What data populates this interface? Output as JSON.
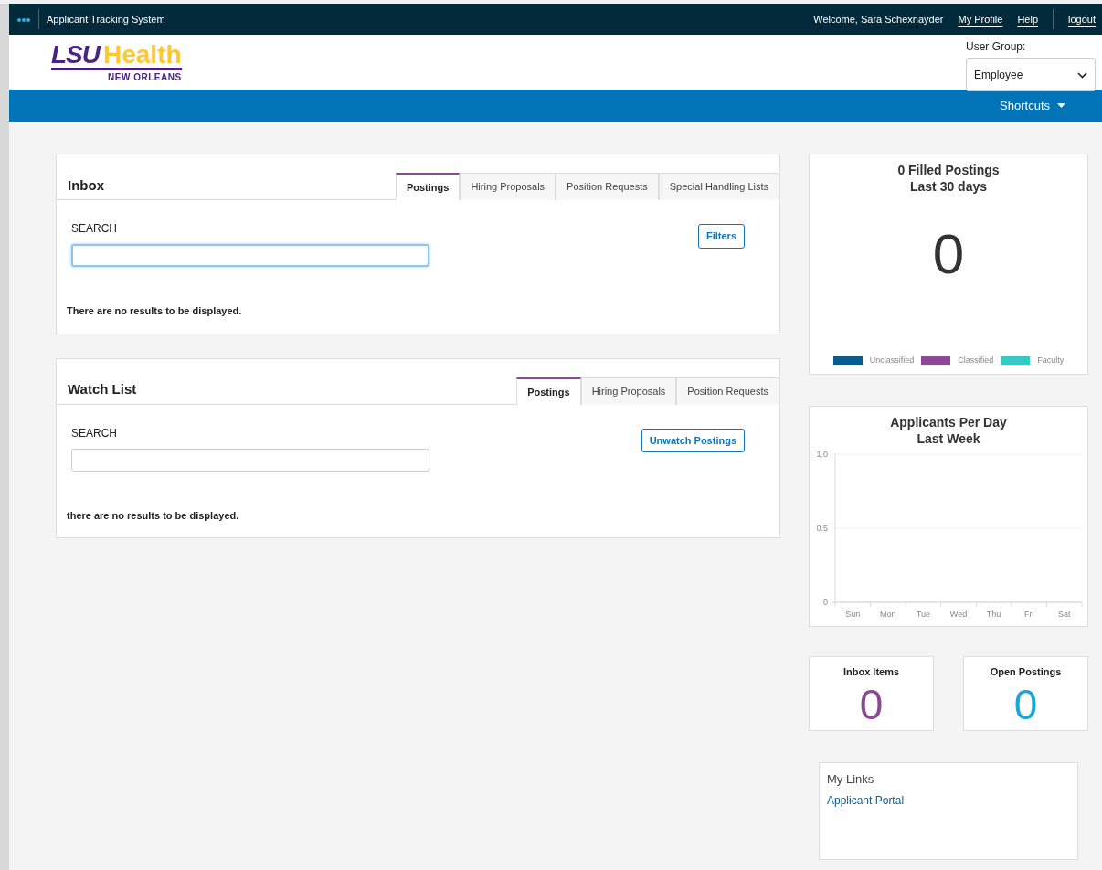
{
  "topbar": {
    "app_title": "Applicant Tracking System",
    "welcome": "Welcome, Sara Schexnayder",
    "links": [
      "My Profile",
      "Help",
      "logout"
    ]
  },
  "logo": {
    "primary": "LSU",
    "secondary": "Health",
    "tagline": "NEW ORLEANS"
  },
  "user_group": {
    "label": "User Group:",
    "value": "Employee"
  },
  "nav": {
    "shortcuts": "Shortcuts"
  },
  "panels": [
    {
      "title": "Inbox",
      "tabs": [
        {
          "label": "Postings",
          "selected": true
        },
        {
          "label": "Hiring Proposals",
          "selected": false
        },
        {
          "label": "Position Requests",
          "selected": false
        },
        {
          "label": "Special Handling Lists",
          "selected": false
        }
      ],
      "search_label": "SEARCH",
      "search_focused": true,
      "action": "Filters",
      "message": "There are no results to be displayed."
    },
    {
      "title": "Watch List",
      "tabs": [
        {
          "label": "Postings",
          "selected": true
        },
        {
          "label": "Hiring Proposals",
          "selected": false
        },
        {
          "label": "Position Requests",
          "selected": false
        }
      ],
      "search_label": "SEARCH",
      "search_focused": false,
      "action": "Unwatch Postings",
      "message": "there are no results to be displayed."
    }
  ],
  "filled_postings": {
    "title": "0 Filled Postings",
    "subtitle": "Last 30 days",
    "value": "0",
    "legend": [
      {
        "label": "Unclassified",
        "color": "#0b5c8e"
      },
      {
        "label": "Classified",
        "color": "#8a4a93"
      },
      {
        "label": "Faculty",
        "color": "#35c9c3"
      }
    ]
  },
  "applicants_chart": {
    "chart_data": {
      "type": "line",
      "title": "Applicants Per Day Last Week",
      "categories": [
        "Sun",
        "Mon",
        "Tue",
        "Wed",
        "Thu",
        "Fri",
        "Sat"
      ],
      "values": [
        null,
        null,
        null,
        null,
        null,
        null,
        null
      ],
      "ylim": [
        0,
        1
      ],
      "yticks": [
        {
          "value": 0,
          "label": "0"
        },
        {
          "value": 0.5,
          "label": "0.5"
        },
        {
          "value": 1,
          "label": "1.0"
        }
      ]
    }
  },
  "stats": [
    {
      "label": "Inbox Items",
      "value": "0",
      "color": "#8a4a93"
    },
    {
      "label": "Open Postings",
      "value": "0",
      "color": "#1aa7d6"
    }
  ],
  "my_links": {
    "title": "My Links",
    "links": [
      "Applicant Portal"
    ]
  }
}
